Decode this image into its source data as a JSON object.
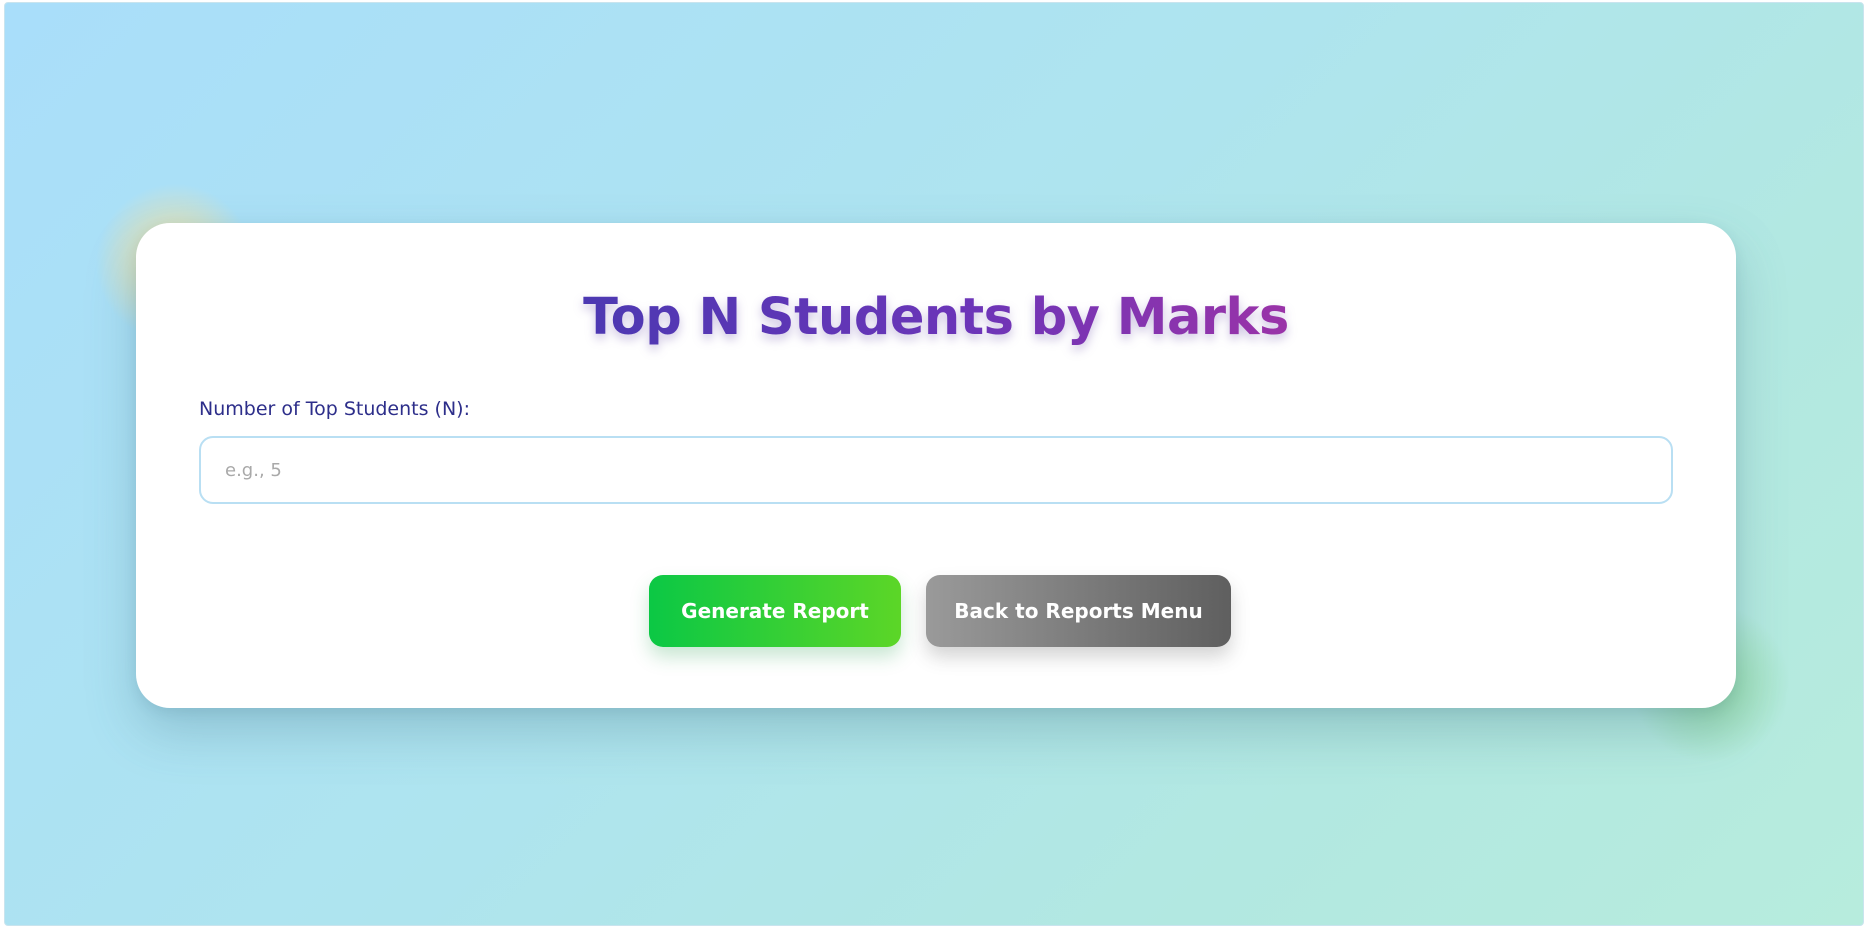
{
  "page": {
    "title": "Top N Students by Marks"
  },
  "form": {
    "n_label": "Number of Top Students (N):",
    "n_placeholder": "e.g., 5",
    "n_value": ""
  },
  "actions": {
    "generate_label": "Generate Report",
    "back_label": "Back to Reports Menu"
  },
  "colors": {
    "title_gradient": [
      "#4c38b2",
      "#9a33a8"
    ],
    "label": "#2d2e8a",
    "generate_button": [
      "#0bc845",
      "#5cd627"
    ],
    "back_button": [
      "#9a9a9a",
      "#5f5f5f"
    ],
    "input_border": "#b9dff3"
  }
}
